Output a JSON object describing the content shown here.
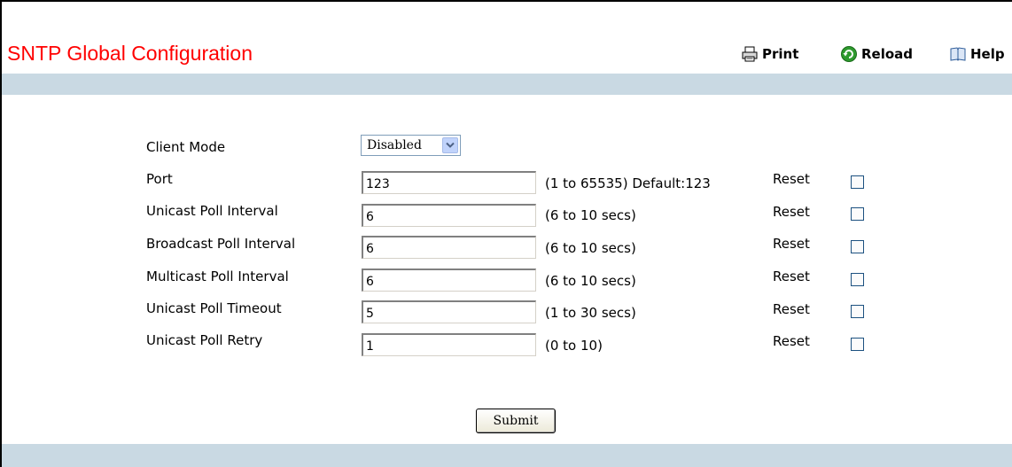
{
  "page": {
    "title": "SNTP Global Configuration"
  },
  "toolbar": {
    "print_label": "Print",
    "reload_label": "Reload",
    "help_label": "Help"
  },
  "form": {
    "client_mode": {
      "label": "Client Mode",
      "value": "Disabled"
    },
    "rows": [
      {
        "label": "Port",
        "value": "123",
        "range": "(1 to 65535) Default:123",
        "reset": "Reset",
        "checked": false
      },
      {
        "label": "Unicast Poll Interval",
        "value": "6",
        "range": "(6 to 10 secs)",
        "reset": "Reset",
        "checked": false
      },
      {
        "label": "Broadcast Poll Interval",
        "value": "6",
        "range": "(6 to 10 secs)",
        "reset": "Reset",
        "checked": false
      },
      {
        "label": "Multicast Poll Interval",
        "value": "6",
        "range": "(6 to 10 secs)",
        "reset": "Reset",
        "checked": false
      },
      {
        "label": "Unicast Poll Timeout",
        "value": "5",
        "range": "(1 to 30 secs)",
        "reset": "Reset",
        "checked": false
      },
      {
        "label": "Unicast Poll Retry",
        "value": "1",
        "range": "(0 to 10)",
        "reset": "Reset",
        "checked": false
      }
    ],
    "submit_label": "Submit"
  },
  "colors": {
    "title": "#ff0000",
    "band": "#c9d9e3",
    "reload_icon": "#2e9a2e"
  },
  "icons": [
    "printer-icon",
    "reload-icon",
    "help-book-icon",
    "chevron-down-icon"
  ]
}
